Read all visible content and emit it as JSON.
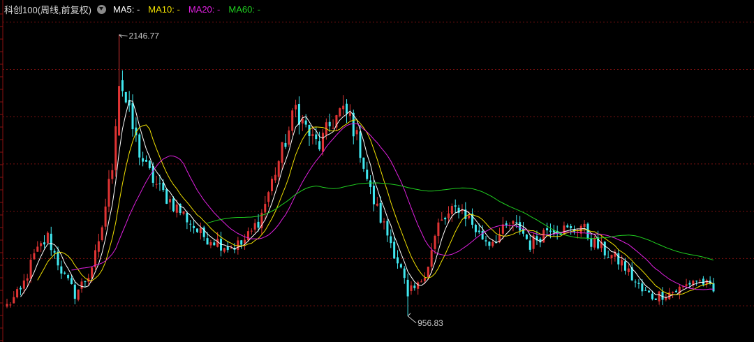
{
  "header": {
    "title": "科创100(周线,前复权)",
    "settings_icon": "chevron-down-circle-icon",
    "ma_items": [
      {
        "label": "MA5:",
        "value": "-",
        "color": "#ffffff"
      },
      {
        "label": "MA10:",
        "value": "-",
        "color": "#f0e000"
      },
      {
        "label": "MA20:",
        "value": "-",
        "color": "#e020e0"
      },
      {
        "label": "MA60:",
        "value": "-",
        "color": "#20d020"
      }
    ]
  },
  "chart_data": {
    "type": "candlestick",
    "title": "科创100(周线,前复权)",
    "grid": "horizontal dashed, dark red",
    "colors": {
      "up": "#e03434",
      "down": "#40e8f0",
      "ma5": "#ffffff",
      "ma10": "#f0e000",
      "ma20": "#e020e0",
      "ma60": "#20d020",
      "grid": "#7a1010"
    },
    "ylim": [
      900,
      2270
    ],
    "annotations": [
      {
        "label": "2146.77",
        "value": 2146.77,
        "type": "high"
      },
      {
        "label": "956.83",
        "value": 956.83,
        "type": "low"
      }
    ],
    "close_path": [
      [
        0,
        1000
      ],
      [
        4,
        1060
      ],
      [
        8,
        1210
      ],
      [
        12,
        1290
      ],
      [
        14,
        1220
      ],
      [
        17,
        1120
      ],
      [
        20,
        1050
      ],
      [
        24,
        1130
      ],
      [
        27,
        1250
      ],
      [
        31,
        1600
      ],
      [
        33,
        1980
      ],
      [
        35,
        1860
      ],
      [
        37,
        1750
      ],
      [
        39,
        1650
      ],
      [
        41,
        1580
      ],
      [
        45,
        1490
      ],
      [
        49,
        1430
      ],
      [
        53,
        1370
      ],
      [
        57,
        1300
      ],
      [
        61,
        1280
      ],
      [
        65,
        1250
      ],
      [
        69,
        1260
      ],
      [
        72,
        1310
      ],
      [
        75,
        1390
      ],
      [
        79,
        1570
      ],
      [
        83,
        1740
      ],
      [
        85,
        1840
      ],
      [
        87,
        1780
      ],
      [
        90,
        1700
      ],
      [
        92,
        1680
      ],
      [
        95,
        1760
      ],
      [
        98,
        1820
      ],
      [
        101,
        1800
      ],
      [
        104,
        1660
      ],
      [
        107,
        1480
      ],
      [
        110,
        1370
      ],
      [
        113,
        1270
      ],
      [
        116,
        1150
      ],
      [
        118,
        1050
      ],
      [
        121,
        1080
      ],
      [
        124,
        1180
      ],
      [
        127,
        1340
      ],
      [
        130,
        1380
      ],
      [
        133,
        1420
      ],
      [
        136,
        1370
      ],
      [
        139,
        1300
      ],
      [
        142,
        1270
      ],
      [
        145,
        1300
      ],
      [
        148,
        1340
      ],
      [
        151,
        1330
      ],
      [
        154,
        1260
      ],
      [
        157,
        1300
      ],
      [
        160,
        1340
      ],
      [
        163,
        1325
      ],
      [
        166,
        1315
      ],
      [
        169,
        1340
      ],
      [
        172,
        1275
      ],
      [
        175,
        1240
      ],
      [
        178,
        1210
      ],
      [
        181,
        1180
      ],
      [
        184,
        1120
      ],
      [
        187,
        1060
      ],
      [
        190,
        1040
      ],
      [
        193,
        1050
      ],
      [
        196,
        1060
      ],
      [
        199,
        1075
      ],
      [
        202,
        1110
      ],
      [
        205,
        1100
      ],
      [
        208,
        1055
      ]
    ]
  }
}
